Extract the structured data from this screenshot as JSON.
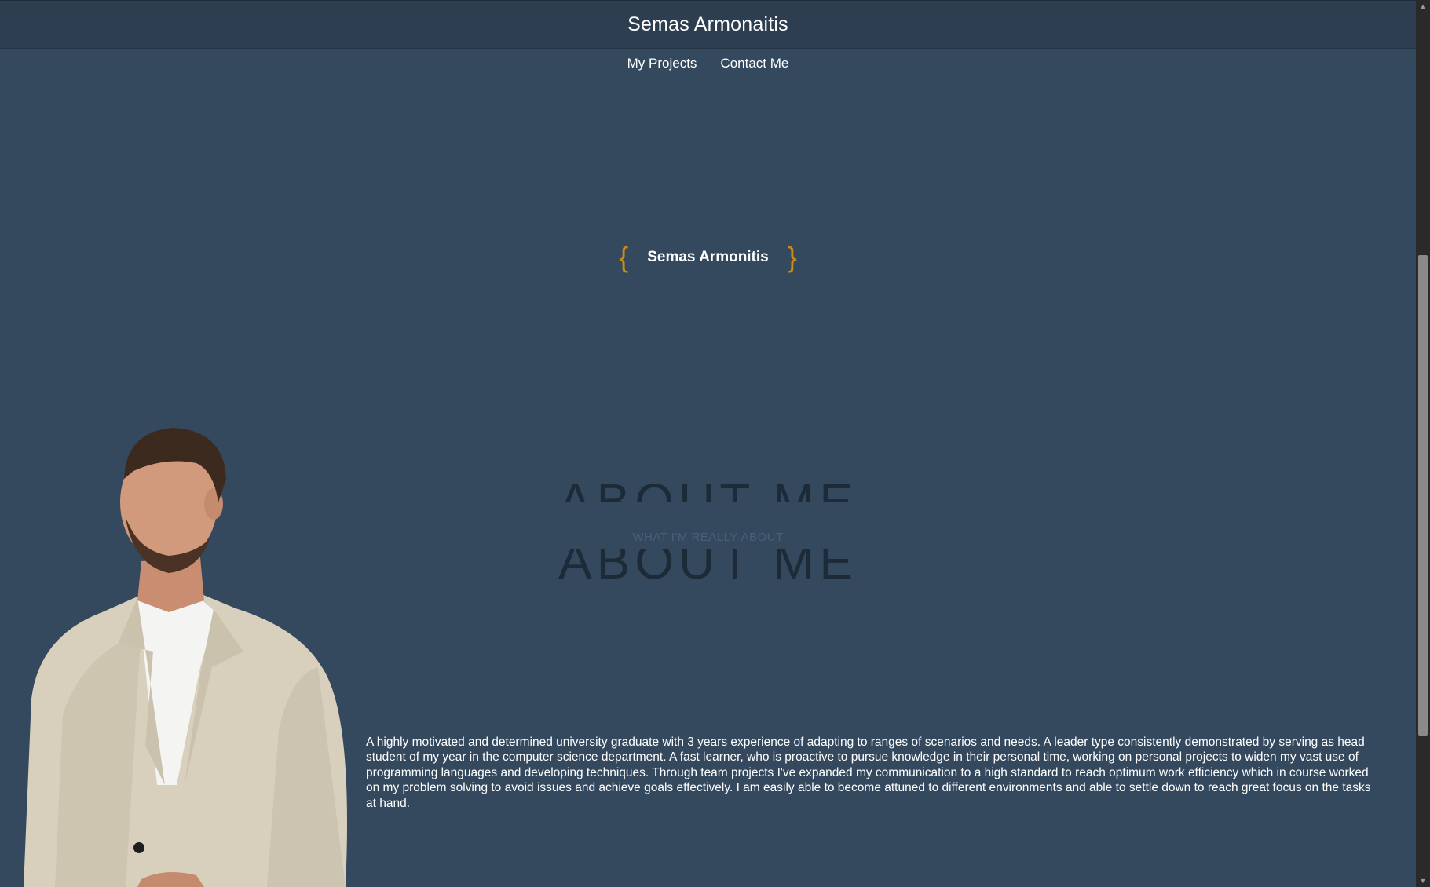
{
  "header": {
    "site_title": "Semas Armonaitis"
  },
  "nav": {
    "items": [
      {
        "label": "My Projects"
      },
      {
        "label": "Contact Me"
      }
    ]
  },
  "hero": {
    "brace_open": "{",
    "name": "Semas Armonitis",
    "brace_close": "}",
    "brace_color": "#c98a18"
  },
  "about": {
    "heading_top": "ABOUT ME",
    "subtitle": "WHAT I'M REALLY ABOUT",
    "heading_bottom": "ABOUT ME",
    "bio": "A highly motivated and determined university graduate with 3 years experience of adapting to ranges of scenarios and needs. A leader type consistently demonstrated by serving as head student of my year in the computer science department. A fast learner, who is proactive to pursue knowledge in their personal time, working on personal projects to widen my vast use of programming languages and developing techniques. Through team projects I've expanded my communication to a high standard to reach optimum work efficiency which in course worked on my problem solving to avoid issues and achieve goals effectively. I am easily able to become attuned to different environments and able to settle down to reach great focus on the tasks at hand."
  },
  "scrollbar": {
    "up_icon": "▲",
    "down_icon": "▼"
  },
  "theme": {
    "background": "#34495e",
    "header_bg": "#2c3e50",
    "accent": "#c98a18"
  }
}
